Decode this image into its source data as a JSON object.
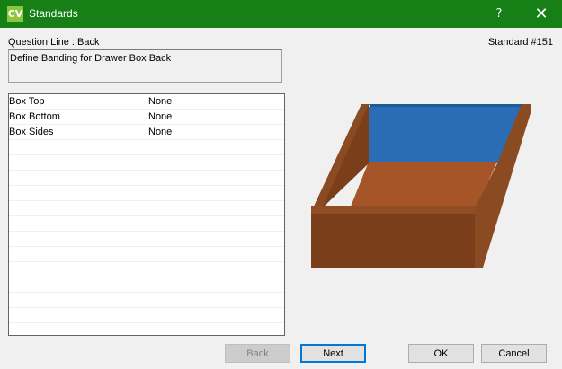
{
  "window": {
    "app_icon_text": "CV",
    "title": "Standards",
    "help_glyph": "?",
    "close_glyph": "✕",
    "title_bar_color": "#167f16"
  },
  "question_line_label": "Question Line : Back",
  "standard_label": "Standard #151",
  "description": "Define Banding for Drawer Box Back",
  "grid": {
    "rows": [
      {
        "name": "Box Top",
        "value": "None"
      },
      {
        "name": "Box Bottom",
        "value": "None"
      },
      {
        "name": "Box Sides",
        "value": "None"
      }
    ]
  },
  "buttons": {
    "back": "Back",
    "next": "Next",
    "ok": "OK",
    "cancel": "Cancel"
  },
  "preview": {
    "highlight_color": "#2a6db5",
    "wood_color": "#7a3f1a"
  }
}
